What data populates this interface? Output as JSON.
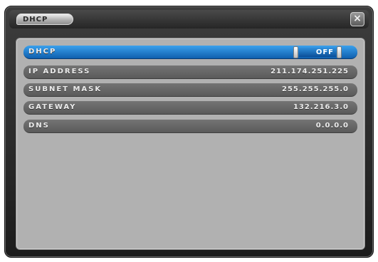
{
  "window": {
    "title": "DHCP",
    "close_glyph": "×",
    "close_icon": "close-icon"
  },
  "settings": {
    "dhcp": {
      "label": "DHCP",
      "value": "OFF"
    },
    "ip_address": {
      "label": "IP ADDRESS",
      "value": "211.174.251.225"
    },
    "subnet_mask": {
      "label": "SUBNET MASK",
      "value": "255.255.255.0"
    },
    "gateway": {
      "label": "GATEWAY",
      "value": "132.216.3.0"
    },
    "dns": {
      "label": "DNS",
      "value": "0.0.0.0"
    }
  },
  "colors": {
    "active_row": "#1f7fd0",
    "inactive_row": "#6a6a6a",
    "content_bg": "#b1b1b1",
    "frame_bg": "#2e2e2e"
  }
}
